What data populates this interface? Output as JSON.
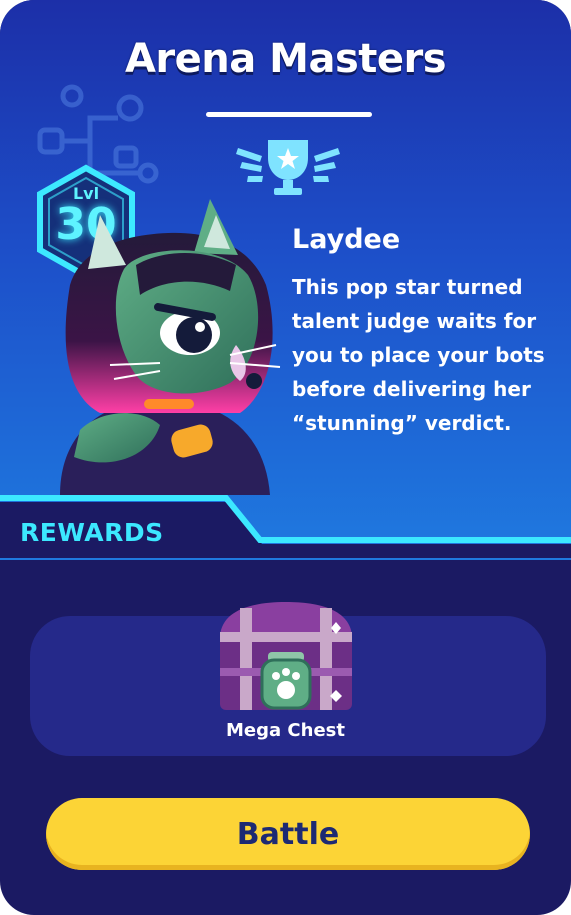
{
  "header": {
    "title": "Arena Masters",
    "trophy_icon": "trophy-icon"
  },
  "opponent": {
    "level_label": "Lvl",
    "level_value": "30",
    "name": "Laydee",
    "description": "This pop star turned talent judge waits for you to place your bots before delivering her “stunning” verdict.",
    "portrait_icon": "cat-popstar-portrait"
  },
  "rewards": {
    "section_label": "REWARDS",
    "items": [
      {
        "name": "Mega Chest",
        "icon": "mega-chest-icon"
      }
    ]
  },
  "actions": {
    "battle_label": "Battle"
  },
  "colors": {
    "panel_top": "#1c2fa8",
    "panel_bottom": "#1f7ae0",
    "background": "#1b1a63",
    "accent_cyan": "#3ce8ff",
    "button_yellow": "#fcd436",
    "button_text": "#1d2a73"
  }
}
